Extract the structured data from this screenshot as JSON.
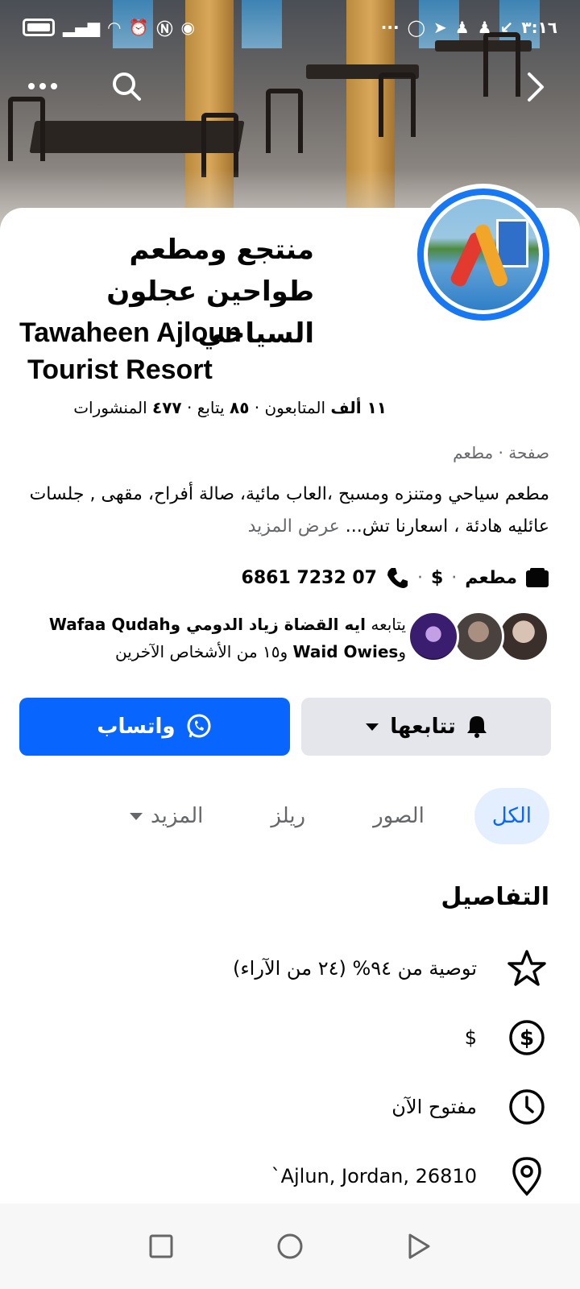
{
  "status_bar": {
    "time": "٣:١٦",
    "left_icons": [
      "battery-icon",
      "signal-icon",
      "wifi-icon",
      "alarm-icon",
      "nfc-icon",
      "eye-icon"
    ],
    "right_icons": [
      "more-dots",
      "whatsapp-icon",
      "telegram-icon",
      "snapchat-icon",
      "snapchat-icon",
      "missed-call-icon"
    ]
  },
  "page": {
    "title_ar": "منتجع ومطعم طواحين عجلون السياحي",
    "title_en_line1": "Tawaheen Ajloun",
    "title_en_line2": "Tourist Resort",
    "stats": {
      "followers_count": "١١ ألف",
      "followers_label": "المتابعون",
      "following_count": "٨٥",
      "following_label": "يتابع",
      "posts_count": "٤٧٧",
      "posts_label": "المنشورات",
      "separator": "·"
    },
    "category": "صفحة · مطعم",
    "description": "مطعم سياحي ومتنزه ومسبح ،العاب مائية، صالة أفراح، مقهى ,  جلسات عائليه  هادئة ، اسعارنا تش...",
    "see_more": "عرض المزيد",
    "info": {
      "category": "مطعم",
      "price": "$",
      "phone": "6861 7232 07"
    },
    "friends_follow": {
      "prefix": "يتابعه",
      "names": "ايه القضاة زياد الدومي و",
      "name2": "Wafaa Qudah",
      "conj": "و",
      "name3": "Waid Owies",
      "suffix": "و١٥ من الأشخاص الآخرين"
    }
  },
  "buttons": {
    "follow": "تتابعها",
    "whatsapp": "واتساب"
  },
  "tabs": [
    {
      "label": "الكل",
      "active": true
    },
    {
      "label": "الصور",
      "active": false
    },
    {
      "label": "ريلز",
      "active": false
    },
    {
      "label": "المزيد",
      "active": false
    }
  ],
  "details": {
    "heading": "التفاصيل",
    "rating": "توصية من ٩٤% (٢٤ من الآراء)",
    "price": "$",
    "hours": "مفتوح الآن",
    "address": "`Ajlun, Jordan, 26810"
  },
  "colors": {
    "accent": "#0866ff",
    "follow_bg": "#e4e6eb",
    "tab_active_bg": "#e3efff",
    "muted": "#65676b"
  }
}
